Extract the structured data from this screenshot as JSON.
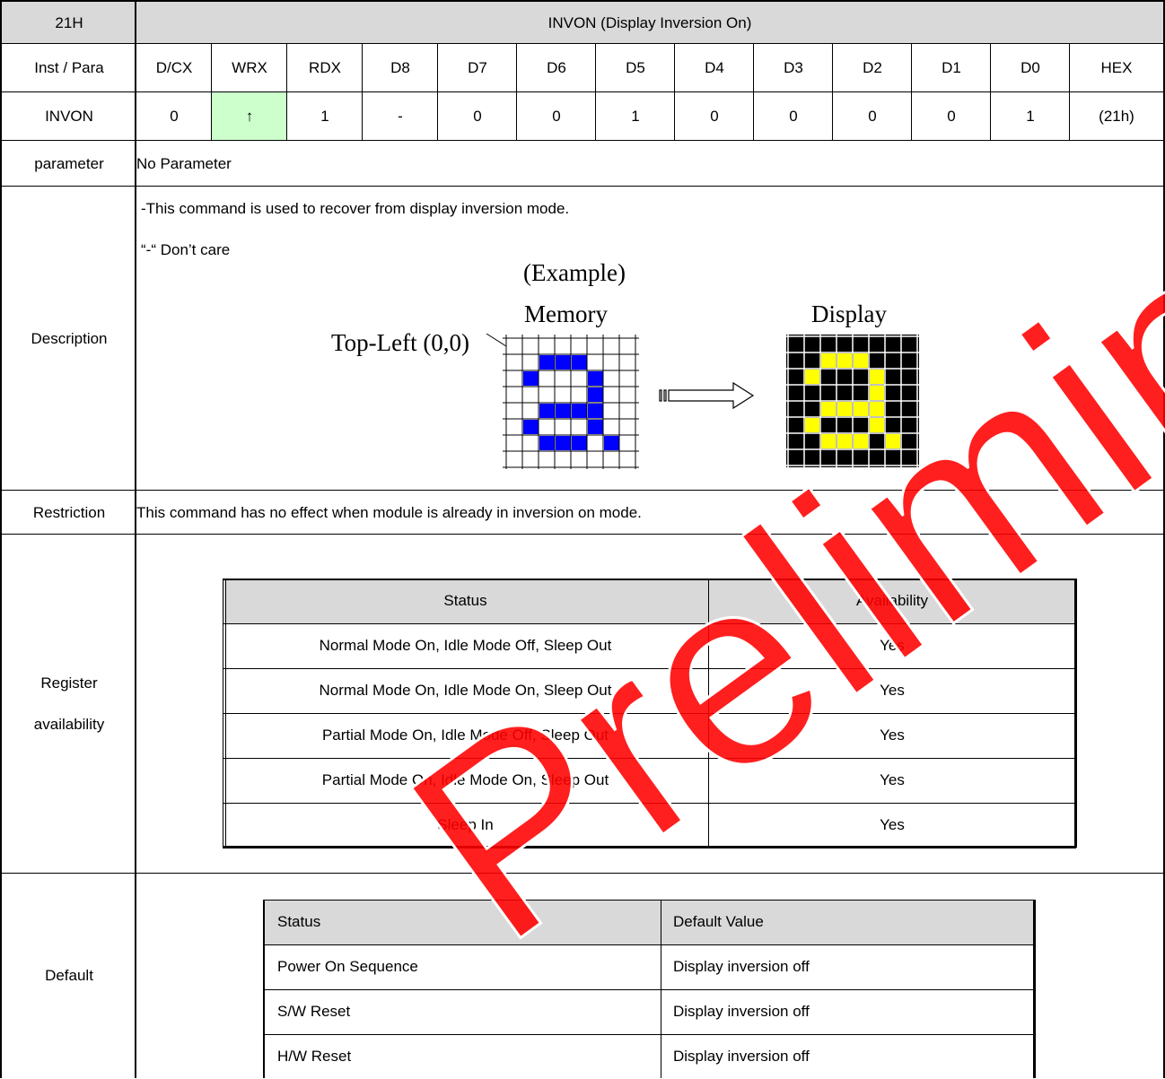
{
  "command": {
    "code": "21H",
    "title": "INVON (Display Inversion On)"
  },
  "bit_header": [
    "Inst / Para",
    "D/CX",
    "WRX",
    "RDX",
    "D8",
    "D7",
    "D6",
    "D5",
    "D4",
    "D3",
    "D2",
    "D1",
    "D0",
    "HEX"
  ],
  "bit_row": [
    "INVON",
    "0",
    "↑",
    "1",
    "-",
    "0",
    "0",
    "1",
    "0",
    "0",
    "0",
    "0",
    "1",
    "(21h)"
  ],
  "colors": {
    "header": "#d9d9d9",
    "wrx_highlight": "#ccffcc",
    "memory_pixel": "#0000ff",
    "display_pixel": "#ffff00",
    "display_bg": "#000000",
    "watermark": "#ff0000"
  },
  "parameter": {
    "label": "parameter",
    "value": "No Parameter"
  },
  "description": {
    "label": "Description",
    "line1": "-This command is used to recover from display inversion mode.",
    "line2": "“-“ Don’t care",
    "example_title": "(Example)",
    "memory_label": "Memory",
    "display_label": "Display",
    "top_left_label": "Top-Left (0,0)"
  },
  "restriction": {
    "label": "Restriction",
    "value": "This command has no effect when module is already in inversion on mode."
  },
  "register_availability": {
    "label_line1": "Register",
    "label_line2": "availability",
    "headers": [
      "Status",
      "Availability"
    ],
    "rows": [
      [
        "Normal Mode On, Idle Mode Off, Sleep Out",
        "Yes"
      ],
      [
        "Normal Mode On, Idle Mode On, Sleep Out",
        "Yes"
      ],
      [
        "Partial Mode On, Idle Mode Off, Sleep Out",
        "Yes"
      ],
      [
        "Partial Mode On, Idle Mode On, Sleep Out",
        "Yes"
      ],
      [
        "Sleep In",
        "Yes"
      ]
    ]
  },
  "default": {
    "label": "Default",
    "headers": [
      "Status",
      "Default Value"
    ],
    "rows": [
      [
        "Power On Sequence",
        "Display inversion off"
      ],
      [
        "S/W Reset",
        "Display inversion off"
      ],
      [
        "H/W Reset",
        "Display inversion off"
      ]
    ]
  },
  "watermark_text": "Preliminary"
}
